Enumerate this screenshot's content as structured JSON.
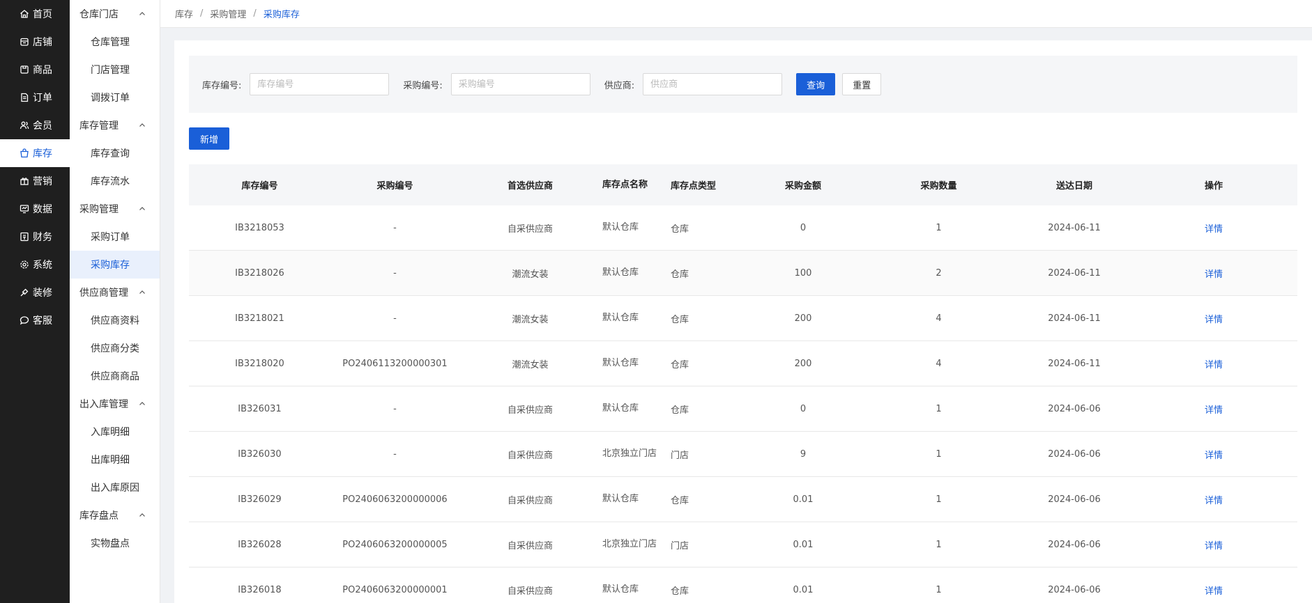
{
  "main_nav": [
    {
      "label": "首页",
      "icon": "home-icon"
    },
    {
      "label": "店铺",
      "icon": "store-icon"
    },
    {
      "label": "商品",
      "icon": "goods-icon"
    },
    {
      "label": "订单",
      "icon": "order-icon"
    },
    {
      "label": "会员",
      "icon": "member-icon"
    },
    {
      "label": "库存",
      "icon": "inventory-icon",
      "active": true
    },
    {
      "label": "营销",
      "icon": "gift-icon"
    },
    {
      "label": "数据",
      "icon": "data-icon"
    },
    {
      "label": "财务",
      "icon": "finance-icon"
    },
    {
      "label": "系统",
      "icon": "settings-icon"
    },
    {
      "label": "装修",
      "icon": "decorate-icon"
    },
    {
      "label": "客服",
      "icon": "chat-icon"
    }
  ],
  "sub_nav": [
    {
      "title": "仓库门店",
      "items": [
        {
          "label": "仓库管理"
        },
        {
          "label": "门店管理"
        },
        {
          "label": "调拨订单"
        }
      ]
    },
    {
      "title": "库存管理",
      "items": [
        {
          "label": "库存查询"
        },
        {
          "label": "库存流水"
        }
      ]
    },
    {
      "title": "采购管理",
      "items": [
        {
          "label": "采购订单"
        },
        {
          "label": "采购库存",
          "active": true
        }
      ]
    },
    {
      "title": "供应商管理",
      "items": [
        {
          "label": "供应商资料"
        },
        {
          "label": "供应商分类"
        },
        {
          "label": "供应商商品"
        }
      ]
    },
    {
      "title": "出入库管理",
      "items": [
        {
          "label": "入库明细"
        },
        {
          "label": "出库明细"
        },
        {
          "label": "出入库原因"
        }
      ]
    },
    {
      "title": "库存盘点",
      "items": [
        {
          "label": "实物盘点"
        }
      ]
    }
  ],
  "breadcrumb": {
    "items": [
      "库存",
      "采购管理",
      "采购库存"
    ],
    "separator": "/"
  },
  "filter": {
    "stock_no": {
      "label": "库存编号:",
      "placeholder": "库存编号",
      "value": ""
    },
    "purchase_no": {
      "label": "采购编号:",
      "placeholder": "采购编号",
      "value": ""
    },
    "supplier": {
      "label": "供应商:",
      "placeholder": "供应商",
      "value": ""
    },
    "query_label": "查询",
    "reset_label": "重置"
  },
  "add_label": "新增",
  "table": {
    "columns": [
      "库存编号",
      "采购编号",
      "首选供应商",
      "库存点名称",
      "库存点类型",
      "采购金额",
      "采购数量",
      "送达日期",
      "操作"
    ],
    "rows": [
      [
        "IB3218053",
        "-",
        "自采供应商",
        "默认仓库",
        "仓库",
        "0",
        "1",
        "2024-06-11",
        "详情"
      ],
      [
        "IB3218026",
        "-",
        "潮流女装",
        "默认仓库",
        "仓库",
        "100",
        "2",
        "2024-06-11",
        "详情"
      ],
      [
        "IB3218021",
        "-",
        "潮流女装",
        "默认仓库",
        "仓库",
        "200",
        "4",
        "2024-06-11",
        "详情"
      ],
      [
        "IB3218020",
        "PO2406113200000301",
        "潮流女装",
        "默认仓库",
        "仓库",
        "200",
        "4",
        "2024-06-11",
        "详情"
      ],
      [
        "IB326031",
        "-",
        "自采供应商",
        "默认仓库",
        "仓库",
        "0",
        "1",
        "2024-06-06",
        "详情"
      ],
      [
        "IB326030",
        "-",
        "自采供应商",
        "北京独立门店",
        "门店",
        "9",
        "1",
        "2024-06-06",
        "详情"
      ],
      [
        "IB326029",
        "PO2406063200000006",
        "自采供应商",
        "默认仓库",
        "仓库",
        "0.01",
        "1",
        "2024-06-06",
        "详情"
      ],
      [
        "IB326028",
        "PO2406063200000005",
        "自采供应商",
        "北京独立门店",
        "门店",
        "0.01",
        "1",
        "2024-06-06",
        "详情"
      ],
      [
        "IB326018",
        "PO2406063200000001",
        "自采供应商",
        "默认仓库",
        "仓库",
        "0.01",
        "1",
        "2024-06-06",
        "详情"
      ]
    ]
  },
  "colors": {
    "accent": "#1a5fd8",
    "nav_bg": "#1f1f1f",
    "active_sub_bg": "#e9f0fc"
  }
}
